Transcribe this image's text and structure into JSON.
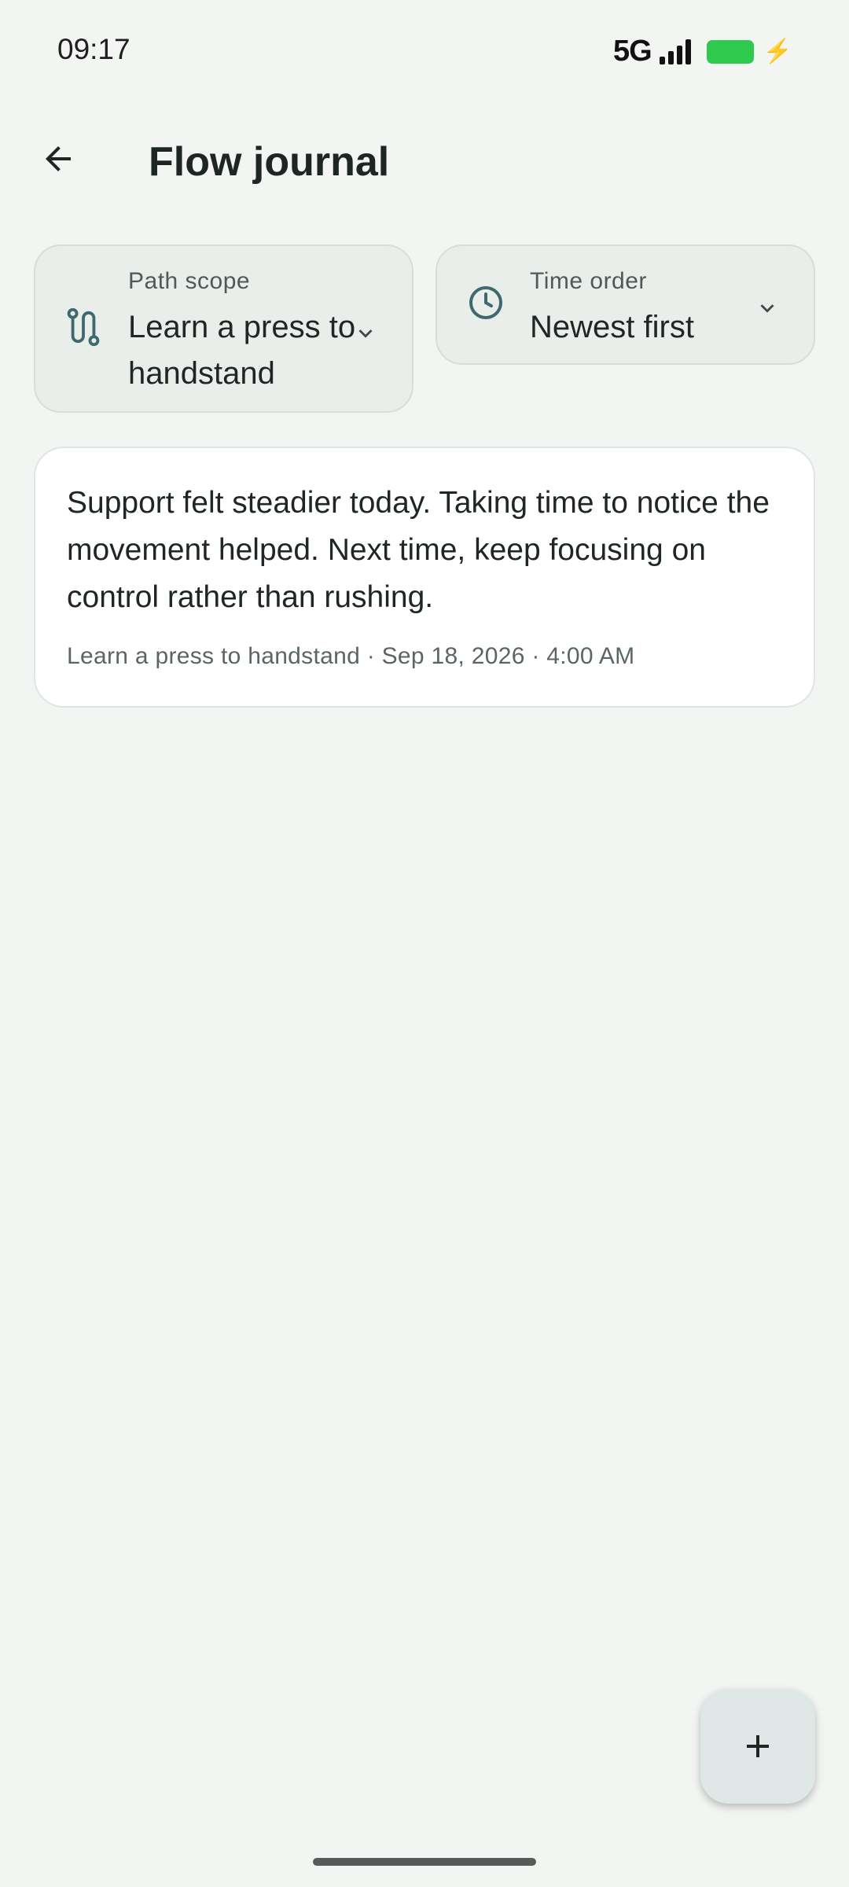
{
  "status_bar": {
    "time": "09:17",
    "network": "5G",
    "battery_color": "#2fc94e"
  },
  "app_bar": {
    "back_icon": "arrow-back-icon",
    "title": "Flow journal"
  },
  "filters": {
    "path_scope": {
      "label": "Path scope",
      "value": "Learn a press to handstand",
      "icon": "route-icon"
    },
    "time_order": {
      "label": "Time order",
      "value": "Newest first",
      "icon": "clock-icon"
    }
  },
  "entries": [
    {
      "text": "Support felt steadier today. Taking time to notice the movement helped. Next time, keep focusing on control rather than rushing.",
      "meta": "Learn a press to handstand · Sep 18, 2026 · 4:00 AM"
    }
  ],
  "fab": {
    "icon": "add-icon"
  },
  "colors": {
    "background": "#f3f5f3",
    "chip_background": "#e9eeeb",
    "accent_icon": "#3e6a6e"
  }
}
